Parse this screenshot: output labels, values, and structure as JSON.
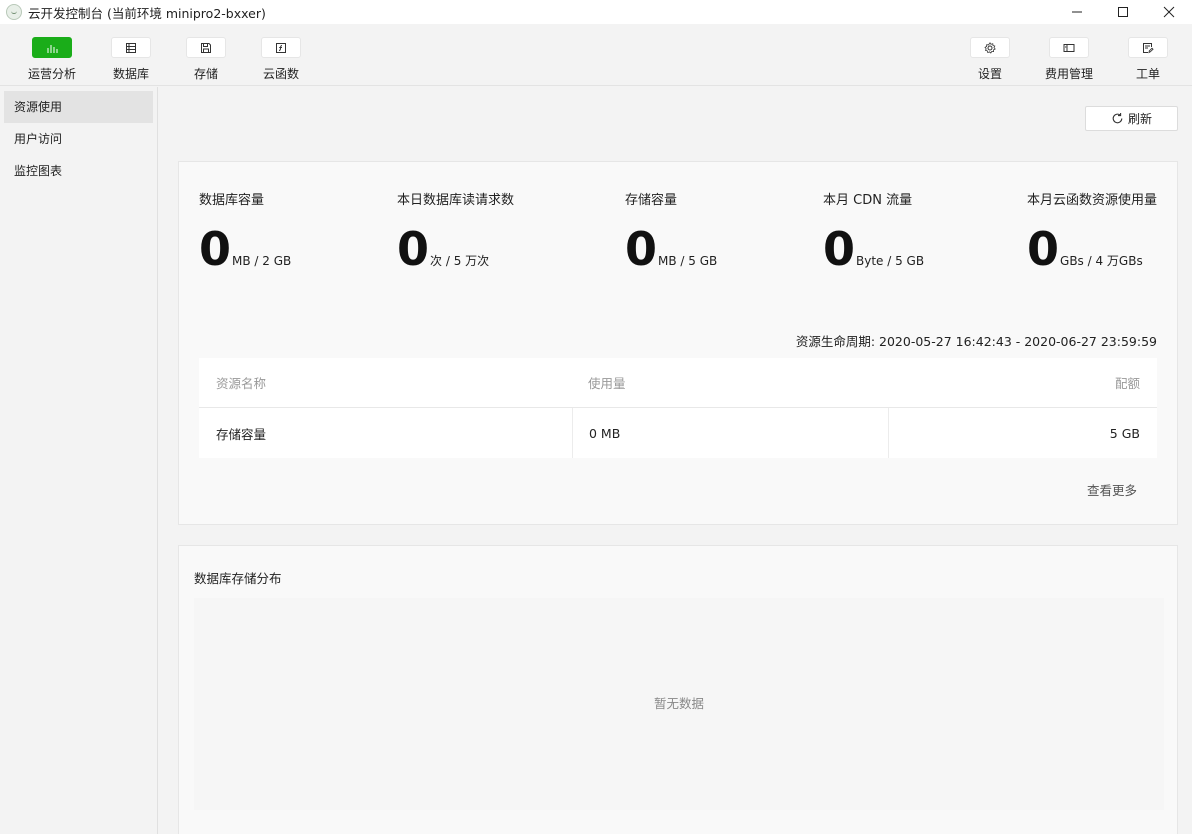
{
  "window": {
    "title": "云开发控制台 (当前环境 minipro2-bxxer)"
  },
  "toolbar": {
    "left": [
      {
        "label": "运营分析",
        "icon": "bar-chart-icon",
        "active": true
      },
      {
        "label": "数据库",
        "icon": "database-icon",
        "active": false
      },
      {
        "label": "存储",
        "icon": "storage-icon",
        "active": false
      },
      {
        "label": "云函数",
        "icon": "function-icon",
        "active": false
      }
    ],
    "right": [
      {
        "label": "设置",
        "icon": "gear-icon"
      },
      {
        "label": "费用管理",
        "icon": "billing-icon"
      },
      {
        "label": "工单",
        "icon": "ticket-icon"
      }
    ],
    "accent_color": "#1aad19"
  },
  "sidebar": {
    "items": [
      {
        "label": "资源使用",
        "active": true
      },
      {
        "label": "用户访问",
        "active": false
      },
      {
        "label": "监控图表",
        "active": false
      }
    ]
  },
  "main": {
    "refresh_label": "刷新",
    "stats": [
      {
        "title": "数据库容量",
        "value": "0",
        "unit": "MB / 2 GB"
      },
      {
        "title": "本日数据库读请求数",
        "value": "0",
        "unit": "次 / 5 万次"
      },
      {
        "title": "存储容量",
        "value": "0",
        "unit": "MB / 5 GB"
      },
      {
        "title": "本月 CDN 流量",
        "value": "0",
        "unit": "Byte / 5 GB"
      },
      {
        "title": "本月云函数资源使用量",
        "value": "0",
        "unit": "GBs / 4 万GBs"
      }
    ],
    "lifecycle": "资源生命周期: 2020-05-27 16:42:43 - 2020-06-27 23:59:59",
    "table": {
      "headers": [
        "资源名称",
        "使用量",
        "配额"
      ],
      "rows": [
        [
          "存储容量",
          "0 MB",
          "5 GB"
        ]
      ]
    },
    "more_label": "查看更多",
    "distribution": {
      "title": "数据库存储分布",
      "empty_text": "暂无数据"
    }
  }
}
